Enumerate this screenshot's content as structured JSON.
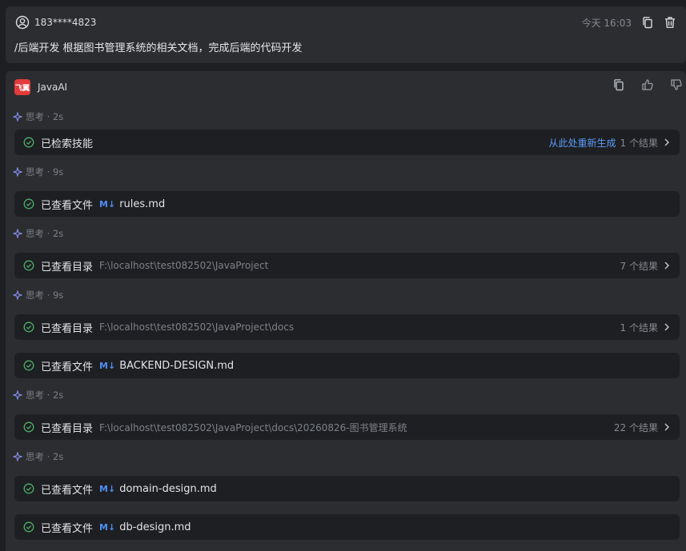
{
  "user": {
    "name": "183****4823",
    "time": "今天 16:03",
    "prompt": "/后端开发 根据图书管理系统的相关文档，完成后端的代码开发"
  },
  "ai": {
    "name": "JavaAI",
    "logo_text": "飞翼"
  },
  "thinking": [
    {
      "label": "思考 · 2s"
    },
    {
      "label": "思考 · 9s"
    },
    {
      "label": "思考 · 2s"
    },
    {
      "label": "思考 · 9s"
    },
    {
      "label": "思考 · 2s"
    },
    {
      "label": "思考 · 2s"
    }
  ],
  "steps": [
    {
      "label": "已检索技能",
      "regen": "从此处重新生成",
      "count": "1 个结果"
    },
    {
      "label": "已查看文件",
      "badge": "M↓",
      "file": "rules.md"
    },
    {
      "label": "已查看目录",
      "path": "F:\\localhost\\test082502\\JavaProject",
      "count": "7 个结果"
    },
    {
      "label": "已查看目录",
      "path": "F:\\localhost\\test082502\\JavaProject\\docs",
      "count": "1 个结果"
    },
    {
      "label": "已查看文件",
      "badge": "M↓",
      "file": "BACKEND-DESIGN.md"
    },
    {
      "label": "已查看目录",
      "path": "F:\\localhost\\test082502\\JavaProject\\docs\\20260826-图书管理系统",
      "count": "22 个结果"
    },
    {
      "label": "已查看文件",
      "badge": "M↓",
      "file": "domain-design.md"
    },
    {
      "label": "已查看文件",
      "badge": "M↓",
      "file": "db-design.md"
    }
  ],
  "colors": {
    "background": "#1e1f22",
    "card": "#2b2d30",
    "accent": "#4e8df5",
    "success": "#4caf6a",
    "logo": "#e23b3b"
  }
}
